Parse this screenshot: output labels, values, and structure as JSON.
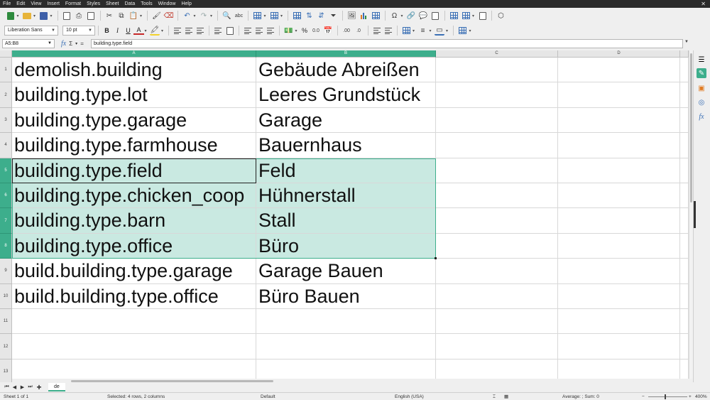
{
  "menu": [
    "File",
    "Edit",
    "View",
    "Insert",
    "Format",
    "Styles",
    "Sheet",
    "Data",
    "Tools",
    "Window",
    "Help"
  ],
  "font": {
    "name": "Liberation Sans",
    "size": "10 pt"
  },
  "format_labels": {
    "bold": "B",
    "italic": "I",
    "underline": "U",
    "font_color": "A",
    "percent": "%"
  },
  "formula_bar": {
    "name_box": "A5:B8",
    "content": "building.type.field",
    "sigma": "Σ",
    "equals": "="
  },
  "columns": [
    "A",
    "B",
    "C",
    "D"
  ],
  "rows": [
    {
      "num": "1",
      "a": "demolish.building",
      "b": "Gebäude Abreißen"
    },
    {
      "num": "2",
      "a": "building.type.lot",
      "b": "Leeres Grundstück"
    },
    {
      "num": "3",
      "a": "building.type.garage",
      "b": "Garage"
    },
    {
      "num": "4",
      "a": "building.type.farmhouse",
      "b": "Bauernhaus"
    },
    {
      "num": "5",
      "a": "building.type.field",
      "b": "Feld"
    },
    {
      "num": "6",
      "a": "building.type.chicken_coop",
      "b": "Hühnerstall"
    },
    {
      "num": "7",
      "a": "building.type.barn",
      "b": "Stall"
    },
    {
      "num": "8",
      "a": "building.type.office",
      "b": "Büro"
    },
    {
      "num": "9",
      "a": "build.building.type.garage",
      "b": "Garage Bauen"
    },
    {
      "num": "10",
      "a": "build.building.type.office",
      "b": "Büro Bauen"
    },
    {
      "num": "11",
      "a": "",
      "b": ""
    },
    {
      "num": "12",
      "a": "",
      "b": ""
    },
    {
      "num": "13",
      "a": "",
      "b": ""
    }
  ],
  "selection": {
    "first_row": 5,
    "last_row": 8,
    "columns": [
      "A",
      "B"
    ]
  },
  "sheet_tab": "de",
  "status": {
    "sheet": "Sheet 1 of 1",
    "selected": "Selected: 4 rows, 2 columns",
    "style": "Default",
    "language": "English (USA)",
    "summary": "Average: ; Sum: 0",
    "zoom": "400%"
  },
  "colors": {
    "accent": "#3dae8c",
    "selection_fill": "#c9e9e1",
    "menubar": "#2b2b2b"
  }
}
